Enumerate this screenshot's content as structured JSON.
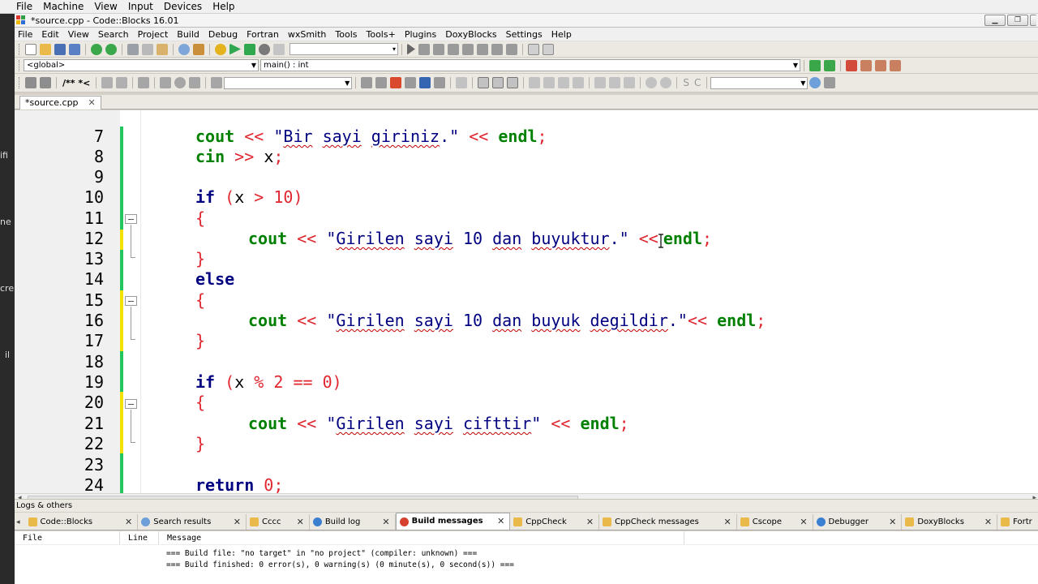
{
  "vbox_menu": [
    "File",
    "Machine",
    "View",
    "Input",
    "Devices",
    "Help"
  ],
  "host_fragments": [
    "ifi",
    "ne",
    "cre",
    "il"
  ],
  "window": {
    "title": "*source.cpp - Code::Blocks 16.01"
  },
  "menubar": [
    "File",
    "Edit",
    "View",
    "Search",
    "Project",
    "Build",
    "Debug",
    "Fortran",
    "wxSmith",
    "Tools",
    "Tools+",
    "Plugins",
    "DoxyBlocks",
    "Settings",
    "Help"
  ],
  "scope_bar": {
    "scope": "<global>",
    "function": "main() : int"
  },
  "editor": {
    "tab_label": "*source.cpp",
    "lines": [
      {
        "no": "7"
      },
      {
        "no": "8"
      },
      {
        "no": "9"
      },
      {
        "no": "10"
      },
      {
        "no": "11"
      },
      {
        "no": "12"
      },
      {
        "no": "13"
      },
      {
        "no": "14"
      },
      {
        "no": "15"
      },
      {
        "no": "16"
      },
      {
        "no": "17"
      },
      {
        "no": "18"
      },
      {
        "no": "19"
      },
      {
        "no": "20"
      },
      {
        "no": "21"
      },
      {
        "no": "22"
      },
      {
        "no": "23"
      },
      {
        "no": "24"
      }
    ],
    "tokens": {
      "cout": "cout",
      "cin": "cin",
      "endl": "endl",
      "if": "if",
      "else": "else",
      "return": "return",
      "lshift": "<<",
      "rshift": ">>",
      "semi": ";",
      "x": "x",
      "gt": ">",
      "mod": "%",
      "eq": "==",
      "n10": "10",
      "n2": "2",
      "n0": "0",
      "lparen": "(",
      "rparen": ")",
      "lbrace": "{",
      "rbrace": "}",
      "q": "\"",
      "s1_a": "Bir",
      "s1_b": "sayi",
      "s1_c": "giriniz",
      "dot": ".",
      "s2_a": "Girilen",
      "s2_b": "sayi",
      "s2_c": "10",
      "s2_d": "dan",
      "s2_e": "buyuktur",
      "s3_e": "buyuk",
      "s3_f": "degildir",
      "s4_c": "cifttir"
    }
  },
  "logs": {
    "header": "Logs & others",
    "tabs": [
      "Code::Blocks",
      "Search results",
      "Cccc",
      "Build log",
      "Build messages",
      "CppCheck",
      "CppCheck messages",
      "Cscope",
      "Debugger",
      "DoxyBlocks",
      "Fortr"
    ],
    "active_tab": "Build messages",
    "columns": [
      "File",
      "Line",
      "Message"
    ],
    "rows": [
      "=== Build file: \"no target\" in \"no project\" (compiler: unknown) ===",
      "=== Build finished: 0 error(s), 0 warning(s) (0 minute(s), 0 second(s)) ==="
    ]
  },
  "colors": {
    "keyword": "#000080",
    "function": "#008000",
    "operator": "#e0262f",
    "string": "#000080",
    "changed_saved": "#22c55e",
    "changed_unsaved": "#f5e100"
  }
}
